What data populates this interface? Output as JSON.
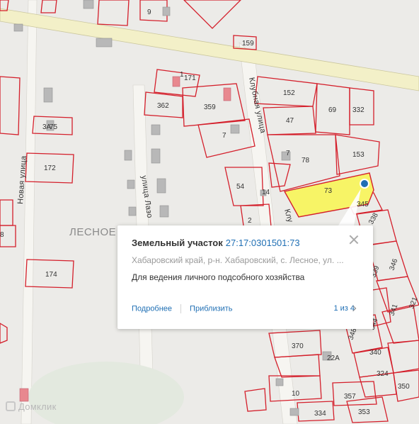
{
  "map": {
    "parcel_labels": [
      "171",
      "362",
      "359",
      "7",
      "152",
      "69",
      "332",
      "47",
      "159",
      "75",
      "172",
      "174",
      "78",
      "153",
      "54",
      "14",
      "73",
      "2",
      "345",
      "338",
      "346",
      "339",
      "341",
      "321",
      "344",
      "340",
      "348",
      "370",
      "22А",
      "324",
      "350",
      "357",
      "334",
      "353",
      "9",
      "10",
      "1",
      "3А",
      "8",
      "7"
    ],
    "streets": [
      "Новая улица",
      "улица Лазо",
      "Клубная улица",
      "Клу"
    ],
    "village": "ЛЕСНОЕ"
  },
  "popup": {
    "title": "Земельный участок",
    "cadastral_number": "27:17:0301501:73",
    "address": "Хабаровский край, р-н. Хабаровский, с. Лесное, ул. ...",
    "use": "Для ведения личного подсобного хозяйства",
    "more_label": "Подробнее",
    "zoom_label": "Приблизить",
    "pager": "1 из 4"
  },
  "watermark": "Домклик",
  "colors": {
    "parcel_border": "#d41f2b",
    "selected_fill": "#f7f466",
    "road": "#f3f0c8",
    "link": "#1f6fb4",
    "marker": "#1f6fb4"
  }
}
